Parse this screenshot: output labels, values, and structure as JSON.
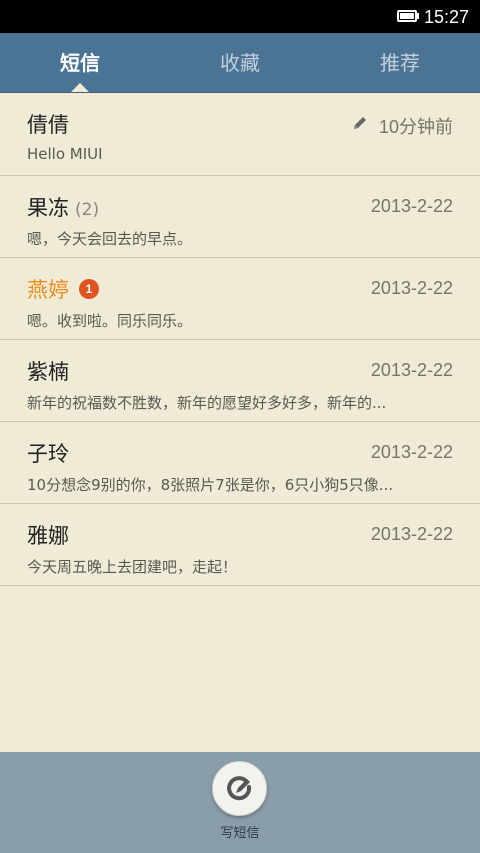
{
  "status_bar": {
    "time": "15:27"
  },
  "tabs": [
    {
      "label": "短信",
      "active": true
    },
    {
      "label": "收藏",
      "active": false
    },
    {
      "label": "推荐",
      "active": false
    }
  ],
  "conversations": [
    {
      "name": "倩倩",
      "preview": "Hello MIUI",
      "time": "10分钟前",
      "draft": true
    },
    {
      "name": "果冻",
      "count": "(2)",
      "preview": "嗯，今天会回去的早点。",
      "time": "2013-2-22"
    },
    {
      "name": "燕婷",
      "badge": "1",
      "unread": true,
      "preview": "嗯。收到啦。同乐同乐。",
      "time": "2013-2-22"
    },
    {
      "name": "紫楠",
      "preview": "新年的祝福数不胜数，新年的愿望好多好多，新年的...",
      "time": "2013-2-22"
    },
    {
      "name": "子玲",
      "preview": "10分想念9别的你，8张照片7张是你，6只小狗5只像...",
      "time": "2013-2-22"
    },
    {
      "name": "雅娜",
      "preview": "今天周五晚上去团建吧，走起！",
      "time": "2013-2-22"
    }
  ],
  "bottom_bar": {
    "compose_label": "写短信",
    "compose_icon": "compose-icon"
  },
  "colors": {
    "header": "#4b7394",
    "background": "#efebd6",
    "unread_name": "#f08c1e",
    "badge": "#e0541f",
    "bottom_bar": "#8a9daa"
  }
}
